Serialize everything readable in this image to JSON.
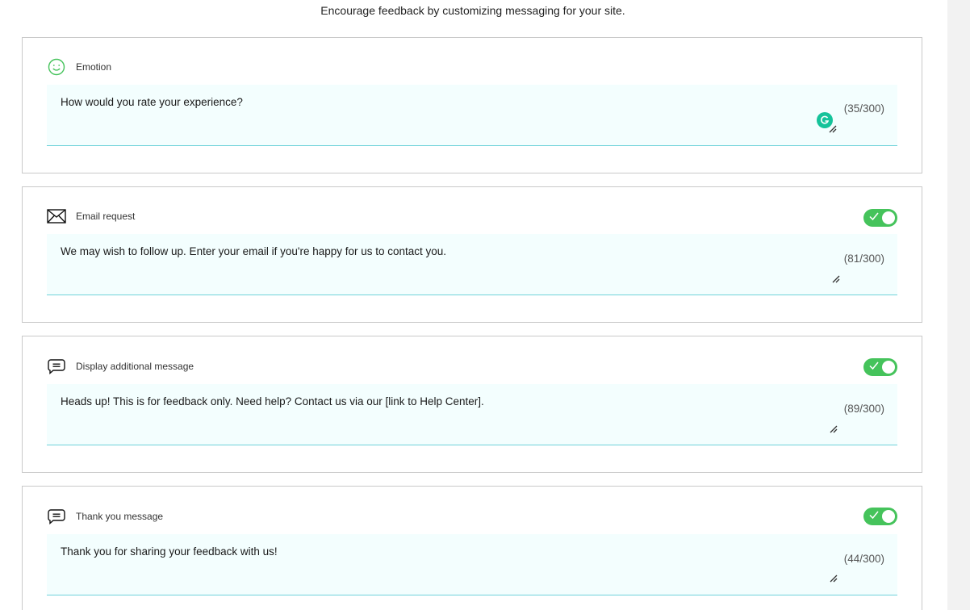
{
  "subtitle": "Encourage feedback by customizing messaging for your site.",
  "colors": {
    "accent_green": "#45c35b",
    "textarea_bg": "#f3fefe",
    "textarea_border": "#6fd2da",
    "grammarly": "#15c39a"
  },
  "cards": [
    {
      "label": "Emotion",
      "icon": "smiley-icon",
      "has_toggle": false,
      "text": "How would you rate your experience?",
      "count": "(35/300)"
    },
    {
      "label": "Email request",
      "icon": "envelope-icon",
      "has_toggle": true,
      "toggle_on": true,
      "text": "We may wish to follow up. Enter your email if you're happy for us to contact you.",
      "count": "(81/300)"
    },
    {
      "label": "Display additional message",
      "icon": "message-icon",
      "has_toggle": true,
      "toggle_on": true,
      "text": "Heads up! This is for feedback only. Need help? Contact us via our [link to Help Center].",
      "count": "(89/300)"
    },
    {
      "label": "Thank you message",
      "icon": "message-icon",
      "has_toggle": true,
      "toggle_on": true,
      "text": "Thank you for sharing your feedback with us!",
      "count": "(44/300)"
    }
  ]
}
